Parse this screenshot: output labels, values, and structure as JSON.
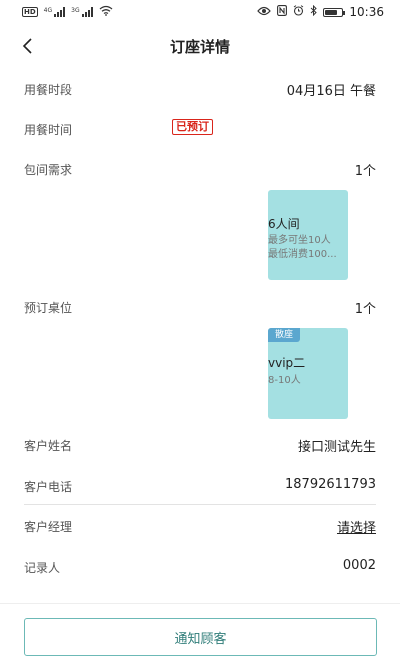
{
  "status_bar": {
    "left_badge": "HD",
    "net1": "4G",
    "net2": "3G",
    "time": "10:36"
  },
  "nav": {
    "title": "订座详情"
  },
  "details": {
    "meal_period": {
      "label": "用餐时段",
      "value": "04月16日 午餐"
    },
    "meal_time": {
      "label": "用餐时间",
      "status_badge": "已预订"
    },
    "room_request": {
      "label": "包间需求",
      "count": "1个",
      "card": {
        "name": "6人间",
        "capacity": "最多可坐10人",
        "min_spend": "最低消费100..."
      }
    },
    "table_booking": {
      "label": "预订桌位",
      "count": "1个",
      "card": {
        "tag": "散座",
        "name": "vvip二",
        "capacity": "8-10人"
      }
    },
    "customer_name": {
      "label": "客户姓名",
      "value": "接口测试先生"
    },
    "customer_phone": {
      "label": "客户电话",
      "value": "18792611793"
    },
    "manager": {
      "label": "客户经理",
      "value": "请选择"
    },
    "recorder": {
      "label": "记录人",
      "value": "0002"
    }
  },
  "actions": {
    "notify_label": "通知顾客"
  },
  "colors": {
    "card_bg": "#a4e0e2",
    "tag_bg": "#5ba7cf",
    "badge_red": "#d9251b",
    "button_border": "#6cb9b6"
  }
}
